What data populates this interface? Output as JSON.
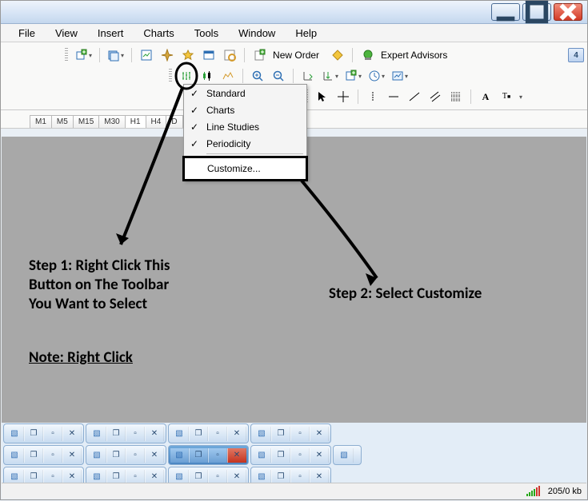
{
  "menu": {
    "file": "File",
    "view": "View",
    "insert": "Insert",
    "charts": "Charts",
    "tools": "Tools",
    "window": "Window",
    "help": "Help"
  },
  "toolbar1": {
    "new_order": "New Order",
    "expert_advisors": "Expert Advisors",
    "badge": "4"
  },
  "period_tabs": [
    "M1",
    "M5",
    "M15",
    "M30",
    "H1",
    "H4",
    "D"
  ],
  "active_period_index": 4,
  "context_menu": {
    "items": [
      {
        "label": "Standard",
        "checked": true
      },
      {
        "label": "Charts",
        "checked": true
      },
      {
        "label": "Line Studies",
        "checked": true
      },
      {
        "label": "Periodicity",
        "checked": true
      }
    ],
    "customize": "Customize..."
  },
  "annotations": {
    "step1": "Step 1: Right Click This\nButton on The Toolbar\nYou Want to Select",
    "step2": "Step 2: Select Customize",
    "note": "Note: Right Click"
  },
  "status": {
    "kb": "205/0 kb"
  }
}
